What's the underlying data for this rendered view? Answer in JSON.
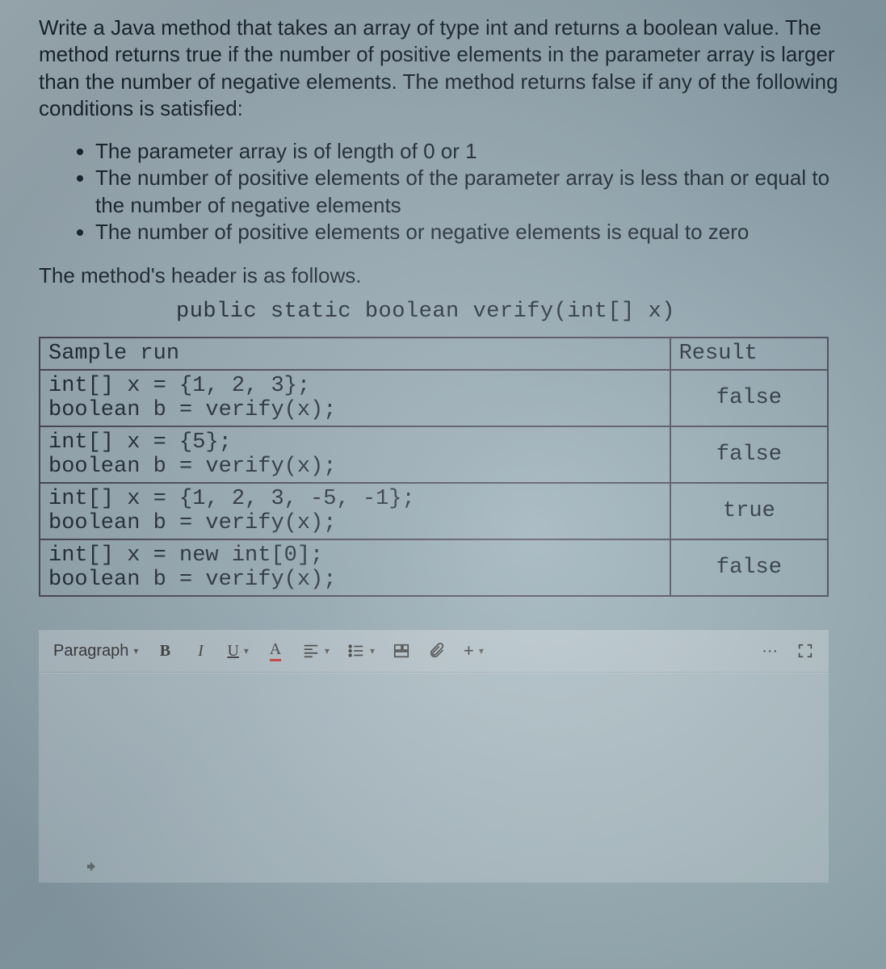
{
  "question": {
    "intro": "Write a Java method that takes an array of type int and returns a boolean value. The method returns true if the number of positive elements in the parameter array is larger than the number of negative elements. The method returns false if any of the following conditions is satisfied:",
    "conditions": [
      "The parameter array is of length of 0 or 1",
      "The number of positive elements of the parameter array is less than or equal to the number of negative elements",
      "The number of positive elements or negative elements is equal to zero"
    ],
    "header_line": "The method's header is as follows.",
    "method_signature": "public static boolean verify(int[] x)"
  },
  "table": {
    "headers": {
      "col1": "Sample run",
      "col2": "Result"
    },
    "rows": [
      {
        "code_line1": "int[] x = {1, 2, 3};",
        "code_line2": "boolean b = verify(x);",
        "result": "false"
      },
      {
        "code_line1": "int[] x = {5};",
        "code_line2": "boolean b = verify(x);",
        "result": "false"
      },
      {
        "code_line1": "int[] x = {1, 2, 3, -5, -1};",
        "code_line2": "boolean b = verify(x);",
        "result": "true"
      },
      {
        "code_line1": "int[] x = new int[0];",
        "code_line2": "boolean b = verify(x);",
        "result": "false"
      }
    ]
  },
  "toolbar": {
    "style_select": "Paragraph",
    "bold": "B",
    "italic": "I",
    "underline": "U",
    "more": "···"
  }
}
